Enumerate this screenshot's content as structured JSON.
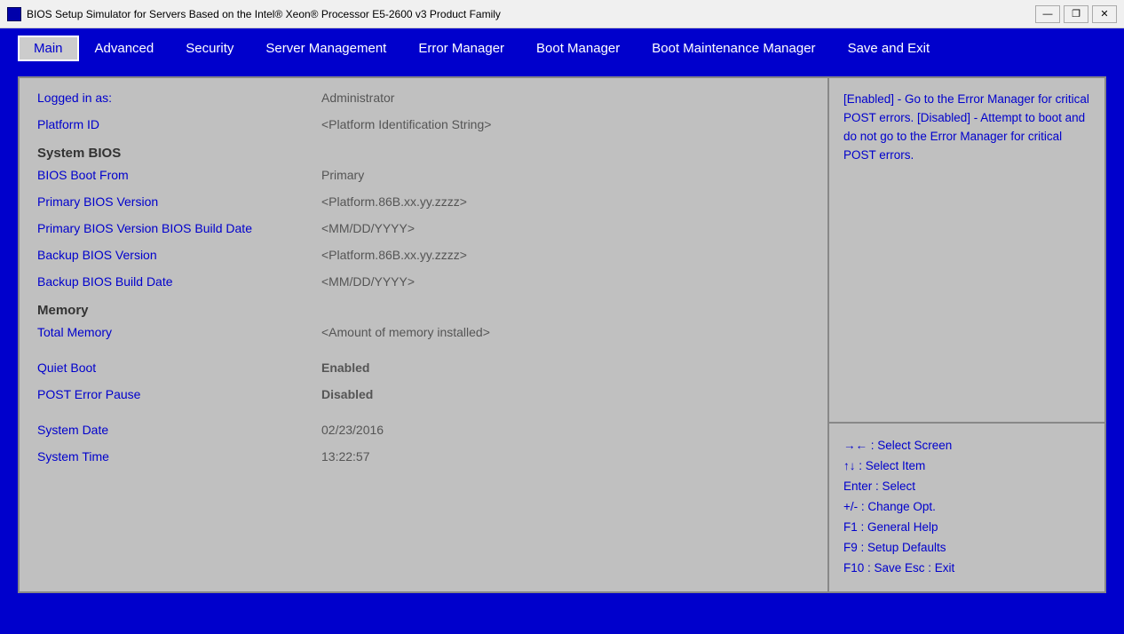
{
  "titlebar": {
    "icon_alt": "app-icon",
    "title": "BIOS Setup Simulator for Servers Based on the Intel® Xeon® Processor E5-2600 v3 Product Family",
    "minimize": "—",
    "restore": "❐",
    "close": "✕"
  },
  "menubar": {
    "items": [
      {
        "id": "main",
        "label": "Main",
        "active": true
      },
      {
        "id": "advanced",
        "label": "Advanced",
        "active": false
      },
      {
        "id": "security",
        "label": "Security",
        "active": false
      },
      {
        "id": "server-management",
        "label": "Server Management",
        "active": false
      },
      {
        "id": "error-manager",
        "label": "Error Manager",
        "active": false
      },
      {
        "id": "boot-manager",
        "label": "Boot Manager",
        "active": false
      },
      {
        "id": "boot-maintenance-manager",
        "label": "Boot Maintenance Manager",
        "active": false
      },
      {
        "id": "save-and-exit",
        "label": "Save and Exit",
        "active": false
      }
    ]
  },
  "main_panel": {
    "rows": [
      {
        "label": "Logged in as:",
        "value": "Administrator",
        "label_style": "blue",
        "value_style": "dark-val"
      },
      {
        "label": "Platform ID",
        "value": "<Platform Identification String>",
        "label_style": "blue",
        "value_style": "normal"
      },
      {
        "type": "section",
        "label": "System BIOS"
      },
      {
        "label": "BIOS Boot From",
        "value": "Primary",
        "label_style": "blue",
        "value_style": "normal"
      },
      {
        "label": "Primary BIOS Version",
        "value": "<Platform.86B.xx.yy.zzzz>",
        "label_style": "blue",
        "value_style": "normal"
      },
      {
        "label": "Primary BIOS Version BIOS Build Date",
        "value": "<MM/DD/YYYY>",
        "label_style": "blue",
        "value_style": "normal"
      },
      {
        "label": "Backup BIOS Version",
        "value": "<Platform.86B.xx.yy.zzzz>",
        "label_style": "blue",
        "value_style": "normal"
      },
      {
        "label": "Backup BIOS Build Date",
        "value": "<MM/DD/YYYY>",
        "label_style": "blue",
        "value_style": "normal"
      },
      {
        "type": "section",
        "label": "Memory"
      },
      {
        "label": "Total Memory",
        "value": "<Amount of memory installed>",
        "label_style": "blue",
        "value_style": "normal"
      },
      {
        "type": "spacer"
      },
      {
        "label": "Quiet Boot",
        "value": "Enabled",
        "label_style": "blue",
        "value_style": "enabled"
      },
      {
        "label": "POST Error Pause",
        "value": "Disabled",
        "label_style": "blue",
        "value_style": "disabled"
      },
      {
        "type": "spacer"
      },
      {
        "label": "System Date",
        "value": "02/23/2016",
        "label_style": "blue",
        "value_style": "normal"
      },
      {
        "label": "System Time",
        "value": "13:22:57",
        "label_style": "blue",
        "value_style": "normal"
      }
    ]
  },
  "right_panel": {
    "help_text": "[Enabled] - Go to the Error Manager for critical POST errors. [Disabled] - Attempt to boot and do not go to the Error Manager for critical POST errors.",
    "keys": [
      {
        "key": "→←",
        "separator": ":",
        "desc": "Select Screen"
      },
      {
        "key": "↑↓",
        "separator": ":",
        "desc": "Select Item"
      },
      {
        "key": "Enter",
        "separator": ":",
        "desc": "Select"
      },
      {
        "key": "+/-",
        "separator": ":",
        "desc": "Change Opt."
      },
      {
        "key": "F1",
        "separator": ":",
        "desc": "General Help"
      },
      {
        "key": "F9",
        "separator": ":",
        "desc": "Setup Defaults"
      },
      {
        "key": "F10",
        "separator": ":",
        "desc": "Save   Esc : Exit"
      }
    ]
  }
}
